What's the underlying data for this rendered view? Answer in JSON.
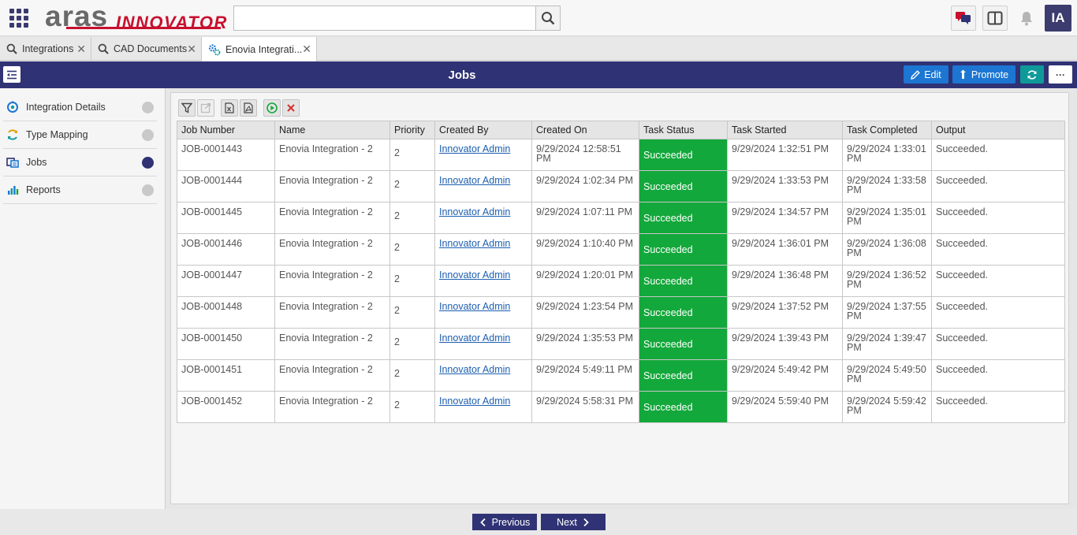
{
  "header": {
    "logo_primary": "aras",
    "logo_secondary": "INNOVATOR",
    "search_value": "",
    "user_initials": "IA"
  },
  "tabs": [
    {
      "label": "Integrations",
      "icon": "search-icon"
    },
    {
      "label": "CAD Documents",
      "icon": "search-icon"
    },
    {
      "label": "Enovia Integrati...",
      "icon": "gears-icon",
      "active": true
    }
  ],
  "titlebar": {
    "title": "Jobs",
    "edit_label": "Edit",
    "promote_label": "Promote",
    "more_label": "···"
  },
  "sidebar": {
    "items": [
      {
        "label": "Integration Details",
        "icon": "integration-icon",
        "active": false
      },
      {
        "label": "Type Mapping",
        "icon": "mapping-icon",
        "active": false
      },
      {
        "label": "Jobs",
        "icon": "jobs-icon",
        "active": true
      },
      {
        "label": "Reports",
        "icon": "reports-icon",
        "active": false
      }
    ]
  },
  "grid": {
    "columns": [
      "Job Number",
      "Name",
      "Priority",
      "Created By",
      "Created On",
      "Task Status",
      "Task Started",
      "Task Completed",
      "Output"
    ],
    "rows": [
      {
        "job": "JOB-0001443",
        "name": "Enovia Integration - 2",
        "priority": "2",
        "created_by": "Innovator Admin",
        "created_on": "9/29/2024 12:58:51 PM",
        "status": "Succeeded",
        "started": "9/29/2024 1:32:51 PM",
        "completed": "9/29/2024 1:33:01 PM",
        "output": "Succeeded."
      },
      {
        "job": "JOB-0001444",
        "name": "Enovia Integration - 2",
        "priority": "2",
        "created_by": "Innovator Admin",
        "created_on": "9/29/2024 1:02:34 PM",
        "status": "Succeeded",
        "started": "9/29/2024 1:33:53 PM",
        "completed": "9/29/2024 1:33:58 PM",
        "output": "Succeeded."
      },
      {
        "job": "JOB-0001445",
        "name": "Enovia Integration - 2",
        "priority": "2",
        "created_by": "Innovator Admin",
        "created_on": "9/29/2024 1:07:11 PM",
        "status": "Succeeded",
        "started": "9/29/2024 1:34:57 PM",
        "completed": "9/29/2024 1:35:01 PM",
        "output": "Succeeded."
      },
      {
        "job": "JOB-0001446",
        "name": "Enovia Integration - 2",
        "priority": "2",
        "created_by": "Innovator Admin",
        "created_on": "9/29/2024 1:10:40 PM",
        "status": "Succeeded",
        "started": "9/29/2024 1:36:01 PM",
        "completed": "9/29/2024 1:36:08 PM",
        "output": "Succeeded."
      },
      {
        "job": "JOB-0001447",
        "name": "Enovia Integration - 2",
        "priority": "2",
        "created_by": "Innovator Admin",
        "created_on": "9/29/2024 1:20:01 PM",
        "status": "Succeeded",
        "started": "9/29/2024 1:36:48 PM",
        "completed": "9/29/2024 1:36:52 PM",
        "output": "Succeeded."
      },
      {
        "job": "JOB-0001448",
        "name": "Enovia Integration - 2",
        "priority": "2",
        "created_by": "Innovator Admin",
        "created_on": "9/29/2024 1:23:54 PM",
        "status": "Succeeded",
        "started": "9/29/2024 1:37:52 PM",
        "completed": "9/29/2024 1:37:55 PM",
        "output": "Succeeded."
      },
      {
        "job": "JOB-0001450",
        "name": "Enovia Integration - 2",
        "priority": "2",
        "created_by": "Innovator Admin",
        "created_on": "9/29/2024 1:35:53 PM",
        "status": "Succeeded",
        "started": "9/29/2024 1:39:43 PM",
        "completed": "9/29/2024 1:39:47 PM",
        "output": "Succeeded."
      },
      {
        "job": "JOB-0001451",
        "name": "Enovia Integration - 2",
        "priority": "2",
        "created_by": "Innovator Admin",
        "created_on": "9/29/2024 5:49:11 PM",
        "status": "Succeeded",
        "started": "9/29/2024 5:49:42 PM",
        "completed": "9/29/2024 5:49:50 PM",
        "output": "Succeeded."
      },
      {
        "job": "JOB-0001452",
        "name": "Enovia Integration - 2",
        "priority": "2",
        "created_by": "Innovator Admin",
        "created_on": "9/29/2024 5:58:31 PM",
        "status": "Succeeded",
        "started": "9/29/2024 5:59:40 PM",
        "completed": "9/29/2024 5:59:42 PM",
        "output": "Succeeded."
      }
    ]
  },
  "pager": {
    "previous_label": "Previous",
    "next_label": "Next"
  },
  "colors": {
    "brand_navy": "#2f3274",
    "brand_red": "#c8102e",
    "accent_blue": "#1c76d2",
    "status_success": "#13a83b"
  }
}
